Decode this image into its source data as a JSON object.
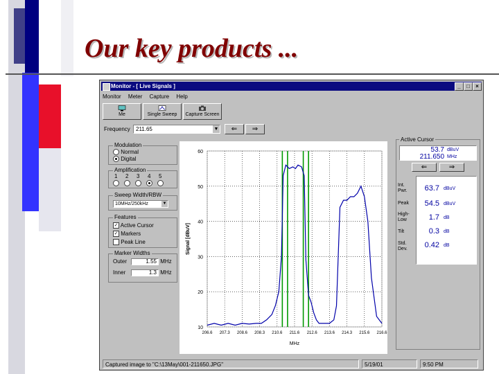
{
  "slide": {
    "title": "Our key products ...",
    "colors": {
      "navy": "#000080",
      "red": "#e8102a",
      "blue": "#3333ff",
      "gray": "#b0b0b8",
      "lightgray": "#d8d8e0",
      "title": "#800000"
    }
  },
  "window": {
    "title": "Monitor - [ Live Signals ]",
    "buttons": {
      "minimize": "_",
      "maximize": "□",
      "close": "×"
    },
    "menu": [
      "Monitor",
      "Meter",
      "Capture",
      "Help"
    ],
    "toolbar": [
      {
        "label": "Me",
        "icon": "monitor-icon"
      },
      {
        "label": "Single Sweep",
        "icon": "sweep-icon"
      },
      {
        "label": "Capture Screen",
        "icon": "camera-icon"
      }
    ],
    "frequency": {
      "label": "Frequency",
      "value": "211.65",
      "left_arrow": "⇐",
      "right_arrow": "⇒"
    },
    "modulation": {
      "label": "Modulation",
      "options": [
        "Normal",
        "Digital"
      ],
      "selected": 1
    },
    "amplification": {
      "label": "Amplification",
      "options": [
        "1",
        "2",
        "3",
        "4",
        "5"
      ],
      "selected": 3
    },
    "sweep": {
      "label": "Sweep Width/RBW",
      "value": "10MHz/250kHz"
    },
    "features": {
      "label": "Features",
      "items": [
        {
          "label": "Active Cursor",
          "checked": true
        },
        {
          "label": "Markers",
          "checked": true
        },
        {
          "label": "Peak Line",
          "checked": false
        }
      ]
    },
    "marker_widths": {
      "label": "Marker Widths",
      "outer_label": "Outer",
      "outer_value": "1.55",
      "inner_label": "Inner",
      "inner_value": "1.3",
      "unit": "MHz"
    },
    "active_cursor": {
      "label": "Active Cursor",
      "level": "53.7",
      "level_unit": "dBuV",
      "freq": "211.650",
      "freq_unit": "MHz",
      "left_arrow": "⇐",
      "right_arrow": "⇒"
    },
    "measurements": [
      {
        "label": "Int. Pwr.",
        "value": "63.7",
        "unit": "dBuV"
      },
      {
        "label": "Peak",
        "value": "54.5",
        "unit": "dBuV"
      },
      {
        "label": "High-Low",
        "value": "1.7",
        "unit": "dB"
      },
      {
        "label": "Tilt",
        "value": "0.3",
        "unit": "dB"
      },
      {
        "label": "Std. Dev.",
        "value": "0.42",
        "unit": "dB"
      }
    ],
    "status": {
      "message": "Captured image to \"C:\\13May\\001-211650.JPG\"",
      "date": "5/19/01",
      "time": "9:50 PM"
    }
  },
  "chart_data": {
    "type": "line",
    "ylabel": "Signal [dBuV]",
    "xlabel": "MHz",
    "ylim": [
      10,
      60
    ],
    "xlim": [
      206.6,
      216.6
    ],
    "yticks": [
      "60",
      "50",
      "40",
      "30",
      "20",
      "10"
    ],
    "xticks": [
      "206.6",
      "207.3",
      "208.6",
      "208.3",
      "210.6",
      "211.6",
      "212.6",
      "213.6",
      "214.3",
      "215.6",
      "216.6"
    ],
    "grid": true,
    "colors": {
      "line": "#0000aa",
      "marker": "#009900"
    },
    "markers": [
      210.9,
      211.2,
      212.1,
      212.4
    ],
    "series": [
      {
        "x": [
          206.6,
          207.0,
          207.4,
          207.8,
          208.2,
          208.6,
          209.0,
          209.4,
          209.7,
          210.0,
          210.3,
          210.5,
          210.7,
          210.85,
          210.95,
          211.1,
          211.3,
          211.5,
          211.65,
          211.8,
          212.0,
          212.15,
          212.25,
          212.4,
          212.55,
          212.7,
          212.85,
          213.0,
          213.3,
          213.6,
          213.85,
          214.0,
          214.1,
          214.2,
          214.4,
          214.6,
          214.8,
          215.0,
          215.2,
          215.4,
          215.6,
          215.8,
          216.0,
          216.3,
          216.6
        ],
        "y": [
          10.5,
          11,
          10.5,
          11,
          10.5,
          11,
          10.8,
          11,
          11,
          12,
          13.5,
          16,
          20,
          30,
          53,
          56,
          55,
          55.5,
          55,
          56,
          55.5,
          53,
          29,
          19,
          17,
          14,
          12,
          11,
          11,
          11,
          12,
          16,
          30,
          44,
          46,
          46,
          47,
          47,
          48,
          50,
          47,
          40,
          24,
          13,
          11
        ]
      }
    ]
  }
}
